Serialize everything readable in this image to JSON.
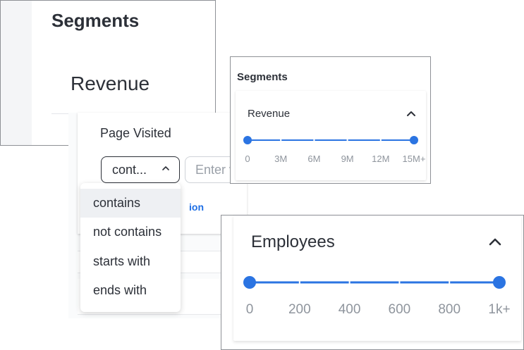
{
  "segments_panel": {
    "title": "Segments",
    "revenue_label": "Revenue"
  },
  "filter_panel": {
    "title": "Page Visited",
    "operator_select": {
      "value": "cont..."
    },
    "value_input": {
      "placeholder": "Enter v"
    },
    "add_condition_link": "ion",
    "menu_options": [
      "contains",
      "not contains",
      "starts with",
      "ends with"
    ],
    "selected_option": "contains"
  },
  "revenue_slider_panel": {
    "title": "Segments",
    "label": "Revenue",
    "ticks": [
      "0",
      "3M",
      "6M",
      "9M",
      "12M",
      "15M+"
    ],
    "range_min": "0",
    "range_max": "15M+"
  },
  "employees_slider_panel": {
    "label": "Employees",
    "ticks": [
      "0",
      "200",
      "400",
      "600",
      "800",
      "1k+"
    ],
    "range_min": "0",
    "range_max": "1k+"
  },
  "colors": {
    "accent": "#2b74e2",
    "text": "#2c3038",
    "muted": "#8f959d",
    "link": "#1f6fe5"
  }
}
